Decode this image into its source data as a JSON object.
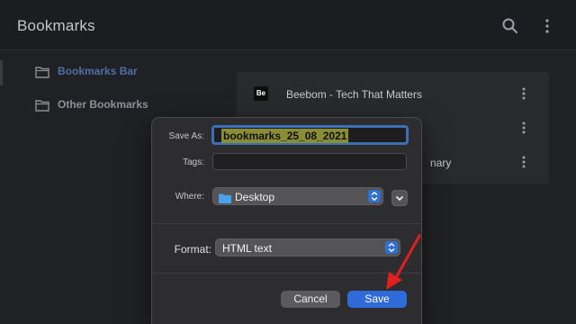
{
  "app": {
    "title": "Bookmarks"
  },
  "icons": {
    "search": "search-icon",
    "menu": "more-vertical-icon",
    "folder": "folder-icon"
  },
  "sidebar": {
    "items": [
      {
        "label": "Bookmarks Bar",
        "active": true
      },
      {
        "label": "Other Bookmarks",
        "active": false
      }
    ]
  },
  "list": {
    "rows": [
      {
        "favicon": "Be",
        "title": "Beebom - Tech That Matters"
      },
      {
        "favicon": "",
        "title": ""
      },
      {
        "favicon": "",
        "title": "nary"
      }
    ]
  },
  "dialog": {
    "save_as_label": "Save As:",
    "save_as_value": "bookmarks_25_08_2021",
    "tags_label": "Tags:",
    "tags_value": "",
    "where_label": "Where:",
    "where_value": "Desktop",
    "format_label": "Format:",
    "format_value": "HTML text",
    "cancel_label": "Cancel",
    "save_label": "Save"
  },
  "colors": {
    "accent": "#2e6bd9",
    "selection": "#8b8d35",
    "arrow": "#e02020",
    "active_sidebar": "#4f6fa6"
  }
}
